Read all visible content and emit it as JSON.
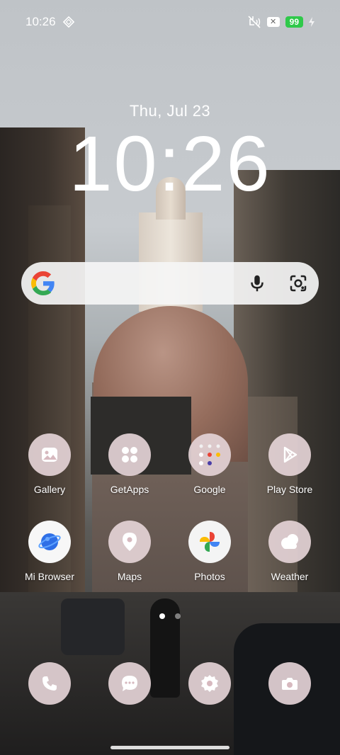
{
  "status_bar": {
    "time": "10:26",
    "battery": "99",
    "icons": [
      "data-saver-icon",
      "vibrate-off-icon",
      "x-badge-icon",
      "charging-icon"
    ]
  },
  "lock": {
    "date": "Thu, Jul 23",
    "time": "10:26"
  },
  "search": {
    "icons": [
      "google-g-icon",
      "microphone-icon",
      "google-lens-icon"
    ]
  },
  "apps": [
    {
      "label": "Gallery",
      "icon": "gallery-icon"
    },
    {
      "label": "GetApps",
      "icon": "getapps-icon"
    },
    {
      "label": "Google",
      "icon": "google-folder-icon"
    },
    {
      "label": "Play Store",
      "icon": "play-store-icon"
    },
    {
      "label": "Mi Browser",
      "icon": "mi-browser-icon"
    },
    {
      "label": "Maps",
      "icon": "maps-icon"
    },
    {
      "label": "Photos",
      "icon": "photos-icon"
    },
    {
      "label": "Weather",
      "icon": "weather-icon"
    }
  ],
  "dock": [
    {
      "icon": "phone-icon"
    },
    {
      "icon": "messages-icon"
    },
    {
      "icon": "settings-icon"
    },
    {
      "icon": "camera-icon"
    }
  ],
  "pages": {
    "count": 2,
    "active": 0
  },
  "colors": {
    "icon_bg": "#e4d2d6",
    "battery": "#2fc94a",
    "search_bg": "#f5f5f5"
  }
}
